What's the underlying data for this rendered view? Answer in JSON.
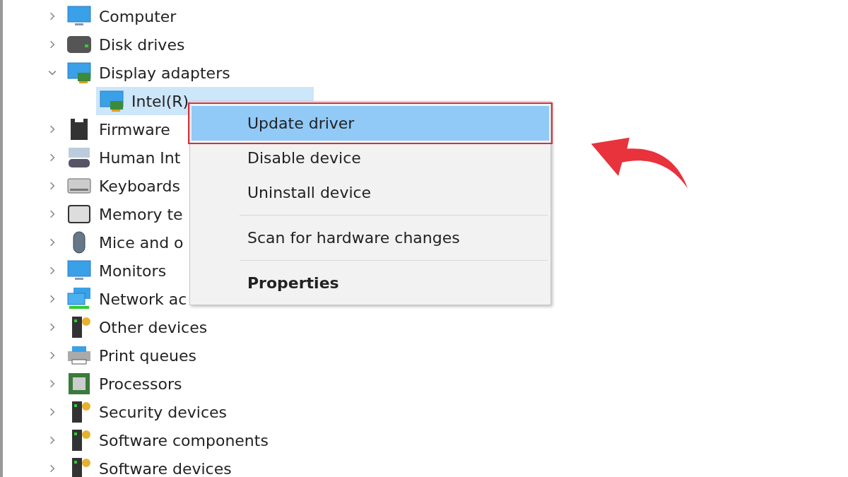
{
  "tree": [
    {
      "label": "Computer",
      "expanded": false,
      "selected": false
    },
    {
      "label": "Disk drives",
      "expanded": false,
      "selected": false
    },
    {
      "label": "Display adapters",
      "expanded": true,
      "selected": false,
      "children": [
        {
          "label": "Intel(R)",
          "selected": true
        }
      ]
    },
    {
      "label": "Firmware",
      "expanded": false,
      "selected": false
    },
    {
      "label": "Human Int",
      "expanded": false,
      "selected": false
    },
    {
      "label": "Keyboards",
      "expanded": false,
      "selected": false
    },
    {
      "label": "Memory te",
      "expanded": false,
      "selected": false
    },
    {
      "label": "Mice and o",
      "expanded": false,
      "selected": false
    },
    {
      "label": "Monitors",
      "expanded": false,
      "selected": false
    },
    {
      "label": "Network ac",
      "expanded": false,
      "selected": false
    },
    {
      "label": "Other devices",
      "expanded": false,
      "selected": false
    },
    {
      "label": "Print queues",
      "expanded": false,
      "selected": false
    },
    {
      "label": "Processors",
      "expanded": false,
      "selected": false
    },
    {
      "label": "Security devices",
      "expanded": false,
      "selected": false
    },
    {
      "label": "Software components",
      "expanded": false,
      "selected": false
    },
    {
      "label": "Software devices",
      "expanded": false,
      "selected": false
    }
  ],
  "context_menu": {
    "items": [
      {
        "kind": "command",
        "label": "Update driver",
        "selected": true,
        "default": false
      },
      {
        "kind": "command",
        "label": "Disable device",
        "selected": false,
        "default": false
      },
      {
        "kind": "command",
        "label": "Uninstall device",
        "selected": false,
        "default": false
      },
      {
        "kind": "separator"
      },
      {
        "kind": "command",
        "label": "Scan for hardware changes",
        "selected": false,
        "default": false
      },
      {
        "kind": "separator"
      },
      {
        "kind": "command",
        "label": "Properties",
        "selected": false,
        "default": true
      }
    ]
  }
}
